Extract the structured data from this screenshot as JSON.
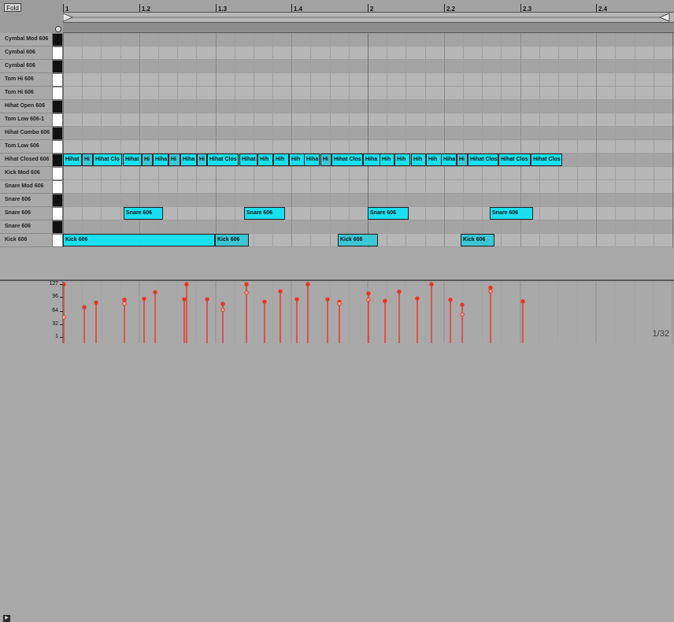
{
  "header": {
    "fold_label": "Fold",
    "bar_labels": [
      "1",
      "1.2",
      "1.3",
      "1.4",
      "2",
      "2.2",
      "2.3",
      "2.4"
    ]
  },
  "keys": [
    {
      "label": "Cymbal Mod 606",
      "piano": "black"
    },
    {
      "label": "Cymbal 606",
      "piano": "white"
    },
    {
      "label": "Cymbal 606",
      "piano": "black"
    },
    {
      "label": "Tom Hi 606",
      "piano": "white"
    },
    {
      "label": "Tom Hi 606",
      "piano": "white"
    },
    {
      "label": "Hihat Open 606",
      "piano": "black"
    },
    {
      "label": "Tom Low 606-1",
      "piano": "white"
    },
    {
      "label": "Hihat Combo 606",
      "piano": "black"
    },
    {
      "label": "Tom Low 606",
      "piano": "white"
    },
    {
      "label": "Hihat Closed 606",
      "piano": "black"
    },
    {
      "label": "Kick Mod 606",
      "piano": "white"
    },
    {
      "label": "Snare Mod 606",
      "piano": "white"
    },
    {
      "label": "Snare 606",
      "piano": "black"
    },
    {
      "label": "Snare 606",
      "piano": "white"
    },
    {
      "label": "Snare 606",
      "piano": "black"
    },
    {
      "label": "Kick 606",
      "piano": "white"
    }
  ],
  "notes": [
    {
      "row": 9,
      "label": "Hihat",
      "start": 1.0,
      "len": 0.0313,
      "color": "cyan"
    },
    {
      "row": 9,
      "label": "Hi",
      "start": 1.0313,
      "len": 0.0184,
      "color": "teal"
    },
    {
      "row": 9,
      "label": "Hihat Clo",
      "start": 1.0497,
      "len": 0.0479,
      "color": "cyan"
    },
    {
      "row": 9,
      "label": "Hihat",
      "start": 1.0976,
      "len": 0.0315,
      "color": "cyan"
    },
    {
      "row": 9,
      "label": "Hi",
      "start": 1.1291,
      "len": 0.0184,
      "color": "teal"
    },
    {
      "row": 9,
      "label": "Hiha",
      "start": 1.1475,
      "len": 0.0252,
      "color": "cyan"
    },
    {
      "row": 9,
      "label": "Hi",
      "start": 1.1727,
      "len": 0.0197,
      "color": "teal"
    },
    {
      "row": 9,
      "label": "Hiha",
      "start": 1.1924,
      "len": 0.0273,
      "color": "cyan"
    },
    {
      "row": 9,
      "label": "Hi",
      "start": 1.2197,
      "len": 0.0173,
      "color": "teal"
    },
    {
      "row": 9,
      "label": "Hihat Clos",
      "start": 1.237,
      "len": 0.0522,
      "color": "cyan"
    },
    {
      "row": 9,
      "label": "Hihat",
      "start": 1.2892,
      "len": 0.0303,
      "color": "cyan"
    },
    {
      "row": 9,
      "label": "Hih",
      "start": 1.3195,
      "len": 0.0255,
      "color": "cyan"
    },
    {
      "row": 9,
      "label": "Hih",
      "start": 1.345,
      "len": 0.0252,
      "color": "cyan"
    },
    {
      "row": 9,
      "label": "Hih",
      "start": 1.3702,
      "len": 0.0255,
      "color": "cyan"
    },
    {
      "row": 9,
      "label": "Hiha",
      "start": 1.3957,
      "len": 0.0264,
      "color": "cyan"
    },
    {
      "row": 9,
      "label": "Hi",
      "start": 1.4221,
      "len": 0.0185,
      "color": "teal"
    },
    {
      "row": 9,
      "label": "Hihat Clos",
      "start": 1.4406,
      "len": 0.0514,
      "color": "cyan"
    },
    {
      "row": 9,
      "label": "Hiha",
      "start": 1.492,
      "len": 0.0279,
      "color": "cyan"
    },
    {
      "row": 9,
      "label": "Hih",
      "start": 1.5199,
      "len": 0.0243,
      "color": "cyan"
    },
    {
      "row": 9,
      "label": "Hih",
      "start": 1.5442,
      "len": 0.0264,
      "color": "cyan"
    },
    {
      "row": 9,
      "label": "Hih",
      "start": 1.5706,
      "len": 0.0246,
      "color": "cyan"
    },
    {
      "row": 9,
      "label": "Hih",
      "start": 1.5952,
      "len": 0.0252,
      "color": "cyan"
    },
    {
      "row": 9,
      "label": "Hiha",
      "start": 1.6204,
      "len": 0.0261,
      "color": "cyan"
    },
    {
      "row": 9,
      "label": "Hi",
      "start": 1.6465,
      "len": 0.0176,
      "color": "teal"
    },
    {
      "row": 9,
      "label": "Hihat Clos",
      "start": 1.6641,
      "len": 0.0503,
      "color": "cyan"
    },
    {
      "row": 9,
      "label": "Hihat Clos",
      "start": 1.7144,
      "len": 0.0527,
      "color": "cyan"
    },
    {
      "row": 9,
      "label": "Hihat Clos",
      "start": 1.7671,
      "len": 0.0519,
      "color": "cyan"
    },
    {
      "row": 13,
      "label": "Snare 606",
      "start": 1.0991,
      "len": 0.0644,
      "color": "cyan"
    },
    {
      "row": 13,
      "label": "Snare 606",
      "start": 1.2976,
      "len": 0.0673,
      "color": "cyan"
    },
    {
      "row": 13,
      "label": "Snare 606",
      "start": 1.4998,
      "len": 0.0667,
      "color": "cyan"
    },
    {
      "row": 13,
      "label": "Snare 606",
      "start": 1.6999,
      "len": 0.0716,
      "color": "cyan"
    },
    {
      "row": 15,
      "label": "Kick 606",
      "start": 1.0,
      "len": 0.2496,
      "color": "cyan"
    },
    {
      "row": 15,
      "label": "Kick 606",
      "start": 1.2496,
      "len": 0.0552,
      "color": "teal"
    },
    {
      "row": 15,
      "label": "Kick 606",
      "start": 1.4507,
      "len": 0.0656,
      "color": "teal"
    },
    {
      "row": 15,
      "label": "Kick 606",
      "start": 1.6521,
      "len": 0.0552,
      "color": "teal"
    }
  ],
  "velocity": {
    "scale": [
      "127",
      "96",
      "64",
      "32",
      "1"
    ],
    "stems": [
      {
        "pos": 1.0,
        "v": [
          127,
          48
        ]
      },
      {
        "pos": 1.0342,
        "v": [
          72
        ]
      },
      {
        "pos": 1.0528,
        "v": [
          83
        ]
      },
      {
        "pos": 1.0998,
        "v": [
          90,
          81
        ]
      },
      {
        "pos": 1.1313,
        "v": [
          92
        ]
      },
      {
        "pos": 1.15,
        "v": [
          108
        ]
      },
      {
        "pos": 1.1973,
        "v": [
          91
        ]
      },
      {
        "pos": 1.2016,
        "v": [
          127
        ]
      },
      {
        "pos": 1.2345,
        "v": [
          91
        ]
      },
      {
        "pos": 1.2609,
        "v": [
          80,
          66
        ]
      },
      {
        "pos": 1.2999,
        "v": [
          127,
          107
        ]
      },
      {
        "pos": 1.3296,
        "v": [
          85
        ]
      },
      {
        "pos": 1.3557,
        "v": [
          110
        ]
      },
      {
        "pos": 1.3818,
        "v": [
          91
        ]
      },
      {
        "pos": 1.4005,
        "v": [
          127
        ]
      },
      {
        "pos": 1.4327,
        "v": [
          91
        ]
      },
      {
        "pos": 1.4521,
        "v": [
          85,
          81
        ]
      },
      {
        "pos": 1.5005,
        "v": [
          105,
          90
        ]
      },
      {
        "pos": 1.5266,
        "v": [
          87
        ]
      },
      {
        "pos": 1.5507,
        "v": [
          109
        ]
      },
      {
        "pos": 1.5807,
        "v": [
          93
        ]
      },
      {
        "pos": 1.6031,
        "v": [
          127
        ]
      },
      {
        "pos": 1.6347,
        "v": [
          90
        ]
      },
      {
        "pos": 1.6533,
        "v": [
          78,
          55
        ]
      },
      {
        "pos": 1.7001,
        "v": [
          119,
          110
        ]
      },
      {
        "pos": 1.7528,
        "v": [
          86
        ]
      }
    ]
  },
  "status": {
    "grid_zoom": "1/32"
  },
  "colors": {
    "note_cyan": "#19e0f0",
    "note_teal": "#3cc7d4",
    "velocity": "#ee3322",
    "white_key": "#ffffff",
    "black_key": "#111111"
  }
}
